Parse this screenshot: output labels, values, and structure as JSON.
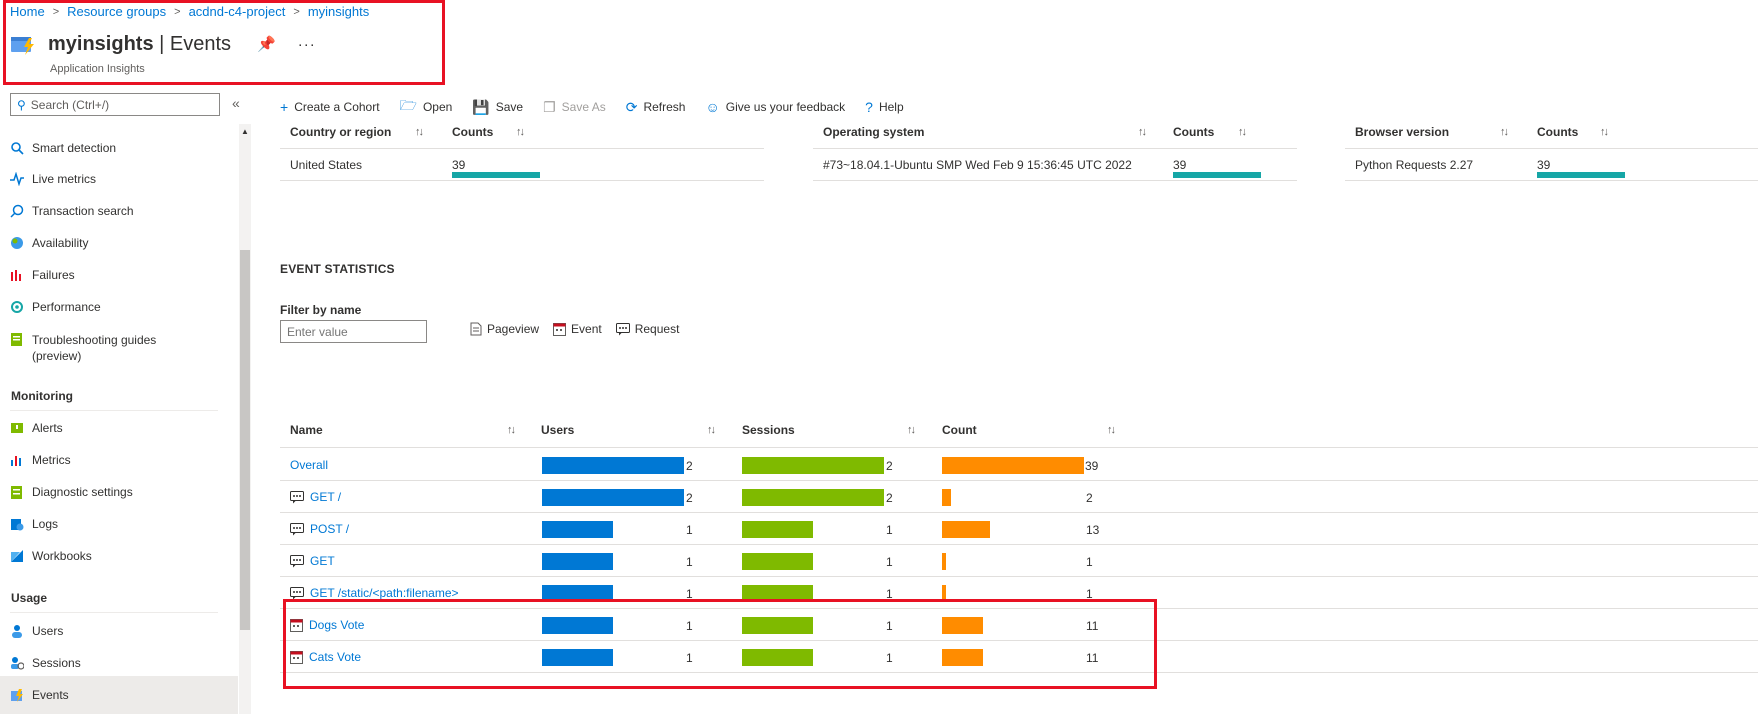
{
  "breadcrumb": [
    "Home",
    "Resource groups",
    "acdnd-c4-project",
    "myinsights"
  ],
  "header": {
    "resource": "myinsights",
    "page": "Events",
    "subtitle": "Application Insights"
  },
  "search": {
    "placeholder": "Search (Ctrl+/)"
  },
  "sidebar": {
    "items_top": [
      {
        "label": "Smart detection",
        "icon": "smart-detection-icon"
      },
      {
        "label": "Live metrics",
        "icon": "live-metrics-icon"
      },
      {
        "label": "Transaction search",
        "icon": "search-icon"
      },
      {
        "label": "Availability",
        "icon": "globe-icon"
      },
      {
        "label": "Failures",
        "icon": "failures-icon"
      },
      {
        "label": "Performance",
        "icon": "performance-icon"
      },
      {
        "label": "Troubleshooting guides",
        "label2": "(preview)",
        "icon": "guide-icon"
      }
    ],
    "monitoring_heading": "Monitoring",
    "monitoring": [
      {
        "label": "Alerts",
        "icon": "alerts-icon"
      },
      {
        "label": "Metrics",
        "icon": "metrics-icon"
      },
      {
        "label": "Diagnostic settings",
        "icon": "diagnostic-icon"
      },
      {
        "label": "Logs",
        "icon": "logs-icon"
      },
      {
        "label": "Workbooks",
        "icon": "workbooks-icon"
      }
    ],
    "usage_heading": "Usage",
    "usage": [
      {
        "label": "Users",
        "icon": "users-icon"
      },
      {
        "label": "Sessions",
        "icon": "sessions-icon"
      },
      {
        "label": "Events",
        "icon": "events-icon"
      }
    ]
  },
  "toolbar": {
    "create_cohort": "Create a Cohort",
    "open": "Open",
    "save": "Save",
    "save_as": "Save As",
    "refresh": "Refresh",
    "feedback": "Give us your feedback",
    "help": "Help"
  },
  "top_tables": [
    {
      "col1": "Country or region",
      "col2": "Counts",
      "value": "United States",
      "count": "39"
    },
    {
      "col1": "Operating system",
      "col2": "Counts",
      "value": "#73~18.04.1-Ubuntu SMP Wed Feb 9 15:36:45 UTC 2022",
      "count": "39"
    },
    {
      "col1": "Browser version",
      "col2": "Counts",
      "value": "Python Requests 2.27",
      "count": "39"
    }
  ],
  "event_stats": {
    "heading": "EVENT STATISTICS",
    "filter_label": "Filter by name",
    "filter_placeholder": "Enter value",
    "legend": [
      "Pageview",
      "Event",
      "Request"
    ],
    "columns": [
      "Name",
      "Users",
      "Sessions",
      "Count"
    ],
    "rows": [
      {
        "name": "Overall",
        "type": "none",
        "users": "2",
        "sessions": "2",
        "count": "39",
        "u": 1.0,
        "s": 1.0,
        "c": 1.0
      },
      {
        "name": "GET /",
        "type": "request",
        "users": "2",
        "sessions": "2",
        "count": "2",
        "u": 1.0,
        "s": 1.0,
        "c": 0.06
      },
      {
        "name": "POST /",
        "type": "request",
        "users": "1",
        "sessions": "1",
        "count": "13",
        "u": 0.5,
        "s": 0.5,
        "c": 0.34
      },
      {
        "name": "GET",
        "type": "request",
        "users": "1",
        "sessions": "1",
        "count": "1",
        "u": 0.5,
        "s": 0.5,
        "c": 0.03
      },
      {
        "name": "GET /static/<path:filename>",
        "type": "request",
        "users": "1",
        "sessions": "1",
        "count": "1",
        "u": 0.5,
        "s": 0.5,
        "c": 0.03
      },
      {
        "name": "Dogs Vote",
        "type": "event",
        "users": "1",
        "sessions": "1",
        "count": "11",
        "u": 0.5,
        "s": 0.5,
        "c": 0.29
      },
      {
        "name": "Cats Vote",
        "type": "event",
        "users": "1",
        "sessions": "1",
        "count": "11",
        "u": 0.5,
        "s": 0.5,
        "c": 0.29
      }
    ]
  },
  "colors": {
    "users_bar": "#0078d4",
    "sessions_bar": "#7fba00",
    "count_bar": "#ff8c00",
    "counts_bar": "#16a6a6",
    "highlight": "#e81123"
  }
}
